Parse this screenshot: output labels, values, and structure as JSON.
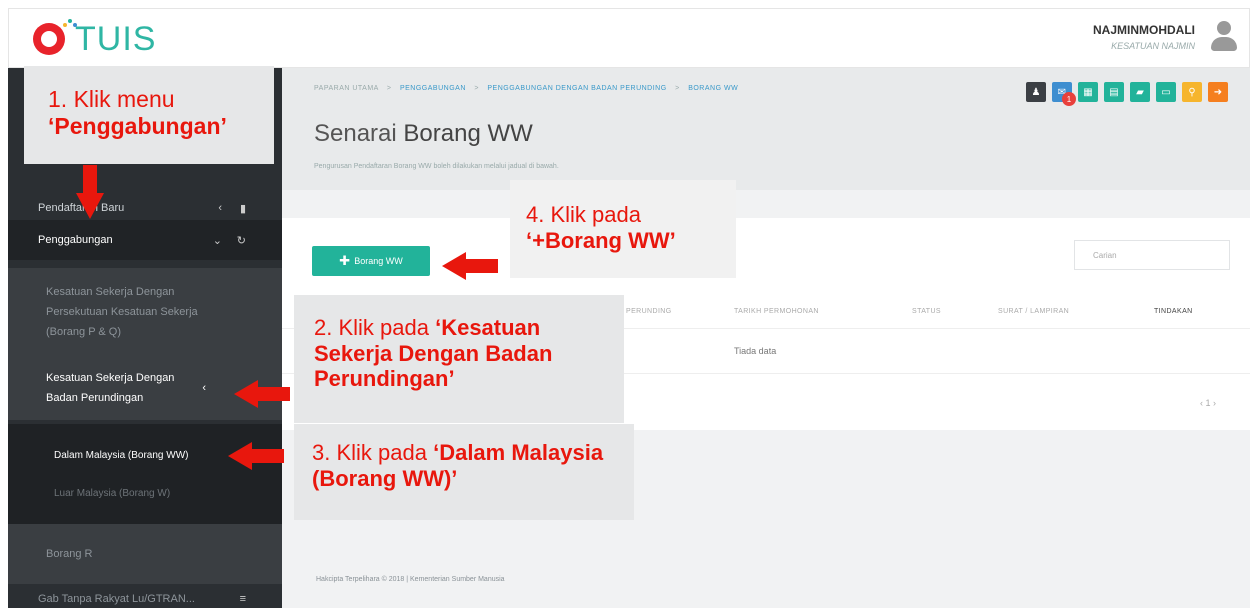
{
  "header": {
    "logo_text": "TUIS",
    "user_name": "NAJMINMOHDALI",
    "user_role": "KESATUAN NAJMIN"
  },
  "sidebar": {
    "pendaftaran_label": "Pendaftaran Baru",
    "penggabungan_label": "Penggabungan",
    "sub1_label": "Kesatuan Sekerja Dengan Persekutuan Kesatuan Sekerja (Borang P & Q)",
    "sub2_label": "Kesatuan Sekerja Dengan Badan Perundingan",
    "dalam_label": "Dalam Malaysia (Borang WW)",
    "luar_label": "Luar Malaysia (Borang W)",
    "borang_r_label": "Borang R",
    "last_label": "Gab Tanpa Rakyat Lu/GTRAN..."
  },
  "breadcrumb": {
    "home": "PAPARAN UTAMA",
    "level1": "PENGGABUNGAN",
    "level2": "PENGGABUNGAN DENGAN BADAN PERUNDING",
    "level3": "BORANG WW",
    "separator": ">"
  },
  "page": {
    "title_prefix": "Senarai",
    "title_bold": "Borang WW",
    "subtitle": "Pengurusan Pendaftaran Borang WW boleh dilakukan melalui jadual di bawah."
  },
  "toolbar": {
    "badge_count": "1",
    "colors": [
      "#3b3f44",
      "#3e8ed0",
      "#22b39a",
      "#22b39a",
      "#22b39a",
      "#22b39a",
      "#f6b52d",
      "#f57f1f"
    ]
  },
  "panel": {
    "add_button_label": "Borang WW",
    "search_placeholder": "Carian",
    "columns": [
      "PERUNDING",
      "TARIKH PERMOHONAN",
      "STATUS",
      "SURAT / LAMPIRAN",
      "TINDAKAN"
    ],
    "empty_text": "Tiada data",
    "pager_text": "‹ 1 ›"
  },
  "footer": {
    "text": "Hakcipta Terpelihara © 2018 | Kementerian Sumber Manusia"
  },
  "annotations": {
    "step1_line1": "1. Klik menu",
    "step1_line2": "‘Penggabungan’",
    "step2_prefix": "2. Klik pada ",
    "step2_bold": "‘Kesatuan Sekerja Dengan Badan Perundingan’",
    "step3_prefix": "3. Klik pada ",
    "step3_bold": "‘Dalam Malaysia (Borang WW)’",
    "step4_line1": "4. Klik pada",
    "step4_line2": "‘+Borang WW’",
    "arrow_color": "#e8170d"
  }
}
